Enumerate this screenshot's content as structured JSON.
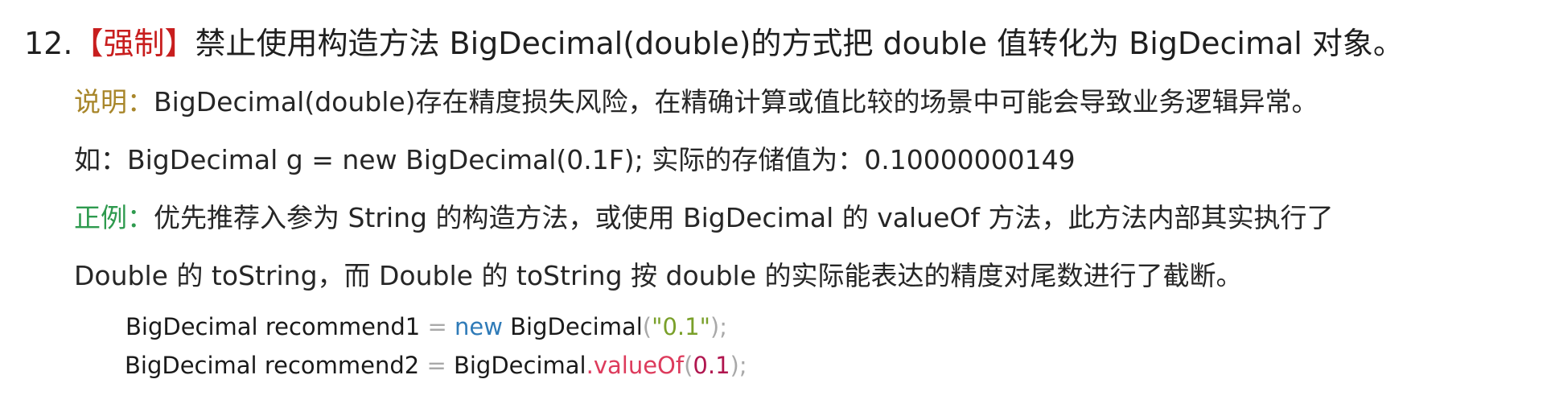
{
  "rule": {
    "number": "12.",
    "tag": "【强制】",
    "text": "禁止使用构造方法 BigDecimal(double)的方式把 double 值转化为 BigDecimal 对象。"
  },
  "note": {
    "label": "说明：",
    "text": "BigDecimal(double)存在精度损失风险，在精确计算或值比较的场景中可能会导致业务逻辑异常。"
  },
  "example_line": "如：BigDecimal g = new BigDecimal(0.1F); 实际的存储值为：0.10000000149",
  "good_example": {
    "label": "正例：",
    "text_line1": "优先推荐入参为 String 的构造方法，或使用 BigDecimal 的 valueOf 方法，此方法内部其实执行了",
    "text_line2": "Double 的 toString，而 Double 的 toString 按 double 的实际能表达的精度对尾数进行了截断。"
  },
  "code": {
    "line1": {
      "decl": "BigDecimal recommend1",
      "op": " = ",
      "kw": "new",
      "type": " BigDecimal",
      "open": "(",
      "str": "\"0.1\"",
      "close": ");"
    },
    "line2": {
      "decl": "BigDecimal recommend2",
      "op": " = ",
      "type": "BigDecimal",
      "dot": ".",
      "method": "valueOf",
      "open": "(",
      "num": "0.1",
      "close": ");"
    }
  },
  "colors": {
    "tag_red": "#c81e1e",
    "note_label": "#a8862a",
    "good_label": "#2e9a4e",
    "keyword_blue": "#2f7bb8",
    "string_green": "#7aa02a",
    "method_pink": "#dd3b5c"
  }
}
